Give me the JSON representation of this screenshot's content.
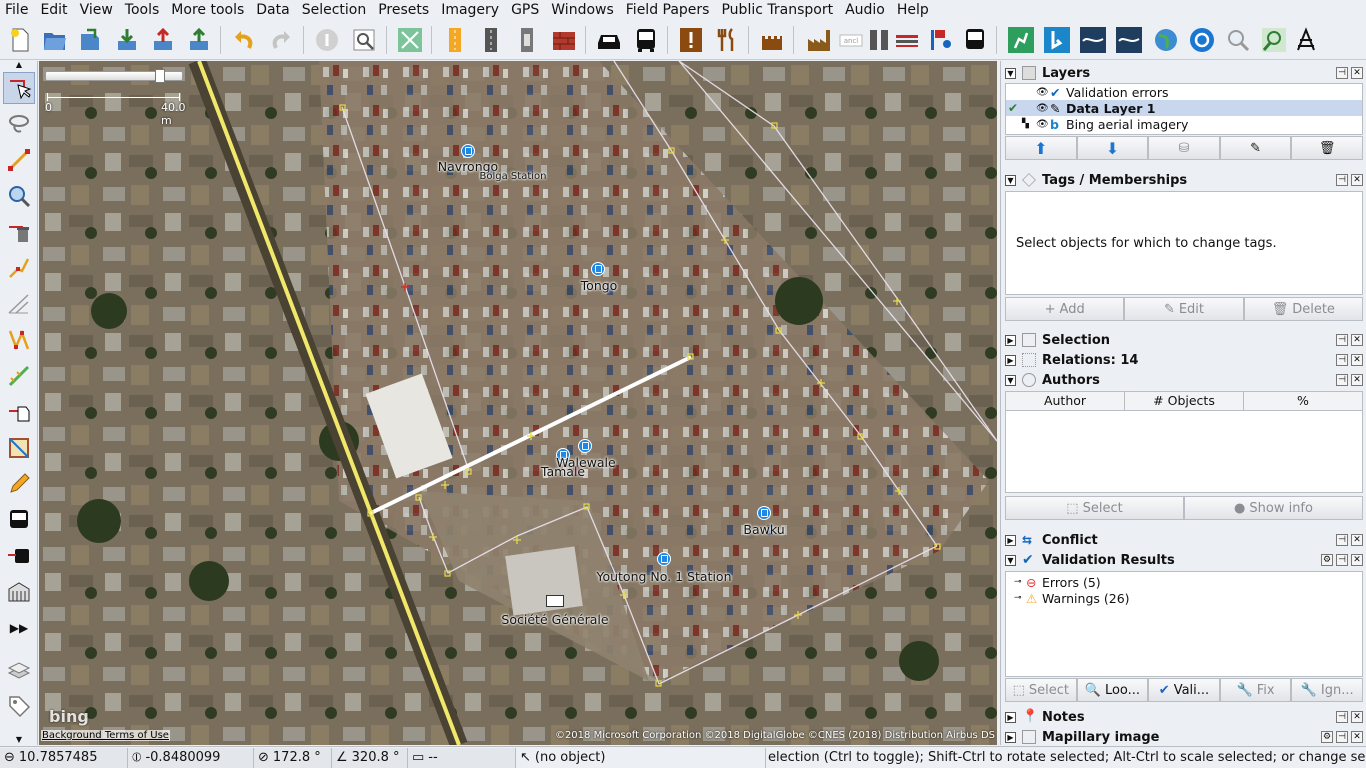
{
  "menu": [
    "File",
    "Edit",
    "View",
    "Tools",
    "More tools",
    "Data",
    "Selection",
    "Presets",
    "Imagery",
    "GPS",
    "Windows",
    "Field Papers",
    "Public Transport",
    "Audio",
    "Help"
  ],
  "toolbar_icons": [
    "new-file-icon",
    "open-file-icon",
    "save-icon",
    "download-icon",
    "upload-icon",
    "upload-changes-icon",
    "undo-icon",
    "redo-icon",
    "info-icon",
    "zoom-data-icon",
    "map-paint-icon",
    "highway-yellow-icon",
    "road-dark-icon",
    "road-light-icon",
    "brick-wall-icon",
    "car-icon",
    "bus-icon",
    "warning-sign-icon",
    "restaurant-icon",
    "castle-icon",
    "factory-icon",
    "address-icon",
    "double-line-icon",
    "stripe-icon",
    "poi-flag-icon",
    "bus-front-icon",
    "walking-icon",
    "bing-b-icon",
    "wave-icon",
    "wave2-icon",
    "globe-icon",
    "compass-icon",
    "magnifier-icon",
    "zoom-map-icon",
    "road-warning-icon"
  ],
  "scale": {
    "start": "0",
    "end": "40.0 m"
  },
  "map": {
    "labels": [
      {
        "text": "Navrongo"
      },
      {
        "text": "Bolga Station"
      },
      {
        "text": "Tongo"
      },
      {
        "text": "Walewale"
      },
      {
        "text": "Tamale"
      },
      {
        "text": "Bawku"
      },
      {
        "text": "Youtong No. 1 Station"
      },
      {
        "text": "Société Générale"
      }
    ],
    "bing_logo": "bing",
    "background_terms": "Background Terms of Use",
    "copyright": "©2018 Microsoft Corporation ©2018 DigitalGlobe ©CNES (2018) Distribution Airbus DS"
  },
  "layers": {
    "title": "Layers",
    "items": [
      {
        "name": "Validation errors",
        "active": false
      },
      {
        "name": "Data Layer 1",
        "active": true
      },
      {
        "name": "Bing aerial imagery",
        "active": false
      }
    ]
  },
  "tags": {
    "title": "Tags / Memberships",
    "empty_message": "Select objects for which to change tags.",
    "add": "Add",
    "edit": "Edit",
    "delete": "Delete"
  },
  "selection_panel": {
    "title": "Selection"
  },
  "relations_panel": {
    "title": "Relations: 14"
  },
  "authors": {
    "title": "Authors",
    "col_author": "Author",
    "col_objects": "# Objects",
    "col_percent": "%",
    "select": "Select",
    "show_info": "Show info"
  },
  "conflict_panel": {
    "title": "Conflict"
  },
  "validation": {
    "title": "Validation Results",
    "errors": "Errors (5)",
    "warnings": "Warnings (26)",
    "btn_select": "Select",
    "btn_lookup": "Loo...",
    "btn_validate": "Vali...",
    "btn_fix": "Fix",
    "btn_ignore": "Ign..."
  },
  "notes_panel": {
    "title": "Notes"
  },
  "mapillary_panel": {
    "title": "Mapillary image"
  },
  "status": {
    "lat": "10.7857485",
    "lon": "-0.8480099",
    "heading": "172.8 °",
    "angle": "320.8 °",
    "length": "--",
    "object": "(no object)",
    "help": "election (Ctrl to toggle); Shift-Ctrl to rotate selected; Alt-Ctrl to scale selected; or change selection"
  },
  "colors": {
    "accent": "#2a6fdb",
    "selected_layer": "#c8d7ee",
    "road_yellow": "#f1e86a"
  }
}
